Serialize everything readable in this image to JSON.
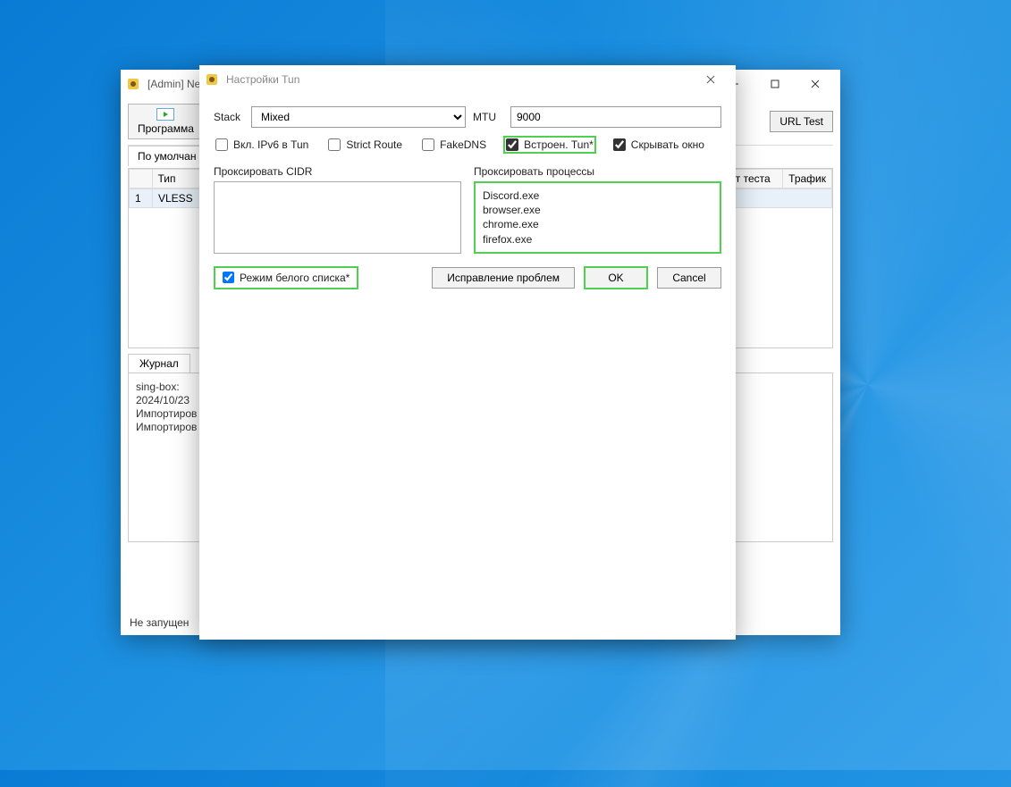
{
  "main": {
    "title": "[Admin] Ne",
    "toolbar": {
      "program_label": "Программа",
      "url_test_label": "URL Test"
    },
    "tabs": {
      "default": "По умолчан"
    },
    "grid": {
      "headers": {
        "num": "",
        "type": "Тип",
        "test": "т теста",
        "traffic": "Трафик"
      },
      "rows": [
        {
          "num": "1",
          "type": "VLESS"
        }
      ]
    },
    "journal": {
      "tab": "Журнал",
      "lines": [
        "sing-box: ",
        "2024/10/23",
        "Импортиров",
        "Импортиров"
      ]
    },
    "status": "Не запущен"
  },
  "dialog": {
    "title": "Настройки Tun",
    "labels": {
      "stack": "Stack",
      "mtu": "MTU",
      "proxy_cidr": "Проксировать CIDR",
      "proxy_proc": "Проксировать процессы"
    },
    "stack_value": "Mixed",
    "mtu_value": "9000",
    "checks": {
      "ipv6": {
        "label": "Вкл. IPv6 в Tun",
        "checked": false
      },
      "strict": {
        "label": "Strict Route",
        "checked": false
      },
      "fakedns": {
        "label": "FakeDNS",
        "checked": false
      },
      "builtin": {
        "label": "Встроен. Tun*",
        "checked": true
      },
      "hide": {
        "label": "Скрывать окно",
        "checked": true
      }
    },
    "cidr_list": [],
    "proc_list": [
      "Discord.exe",
      "browser.exe",
      "chrome.exe",
      "firefox.exe"
    ],
    "whitelist": {
      "label": "Режим белого списка*",
      "checked": true
    },
    "buttons": {
      "fix": "Исправление проблем",
      "ok": "OK",
      "cancel": "Cancel"
    }
  }
}
